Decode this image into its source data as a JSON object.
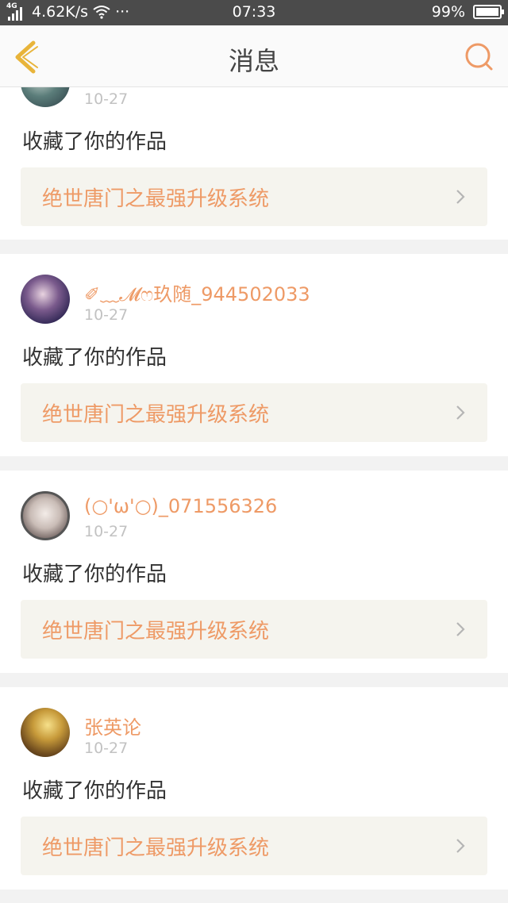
{
  "status_bar": {
    "network": "4G",
    "speed": "4.62K/s",
    "more": "···",
    "time": "07:33",
    "battery": "99%",
    "battery_level": 0.99
  },
  "nav": {
    "title": "消息",
    "back_icon": "chevron-left-icon",
    "search_icon": "search-icon"
  },
  "colors": {
    "accent": "#ee9a66",
    "status_bar": "#4b4b4b",
    "back_arrow": "#e8b43a"
  },
  "messages": [
    {
      "name": "",
      "date": "10-27",
      "action": "收藏了你的作品",
      "work_title": "绝世唐门之最强升级系统"
    },
    {
      "name": "✐﹏𝓜ෆ玖随_944502033",
      "date": "10-27",
      "action": "收藏了你的作品",
      "work_title": "绝世唐门之最强升级系统"
    },
    {
      "name": "(○'ω'○)_071556326",
      "date": "10-27",
      "action": "收藏了你的作品",
      "work_title": "绝世唐门之最强升级系统"
    },
    {
      "name": "张英论",
      "date": "10-27",
      "action": "收藏了你的作品",
      "work_title": "绝世唐门之最强升级系统"
    }
  ]
}
